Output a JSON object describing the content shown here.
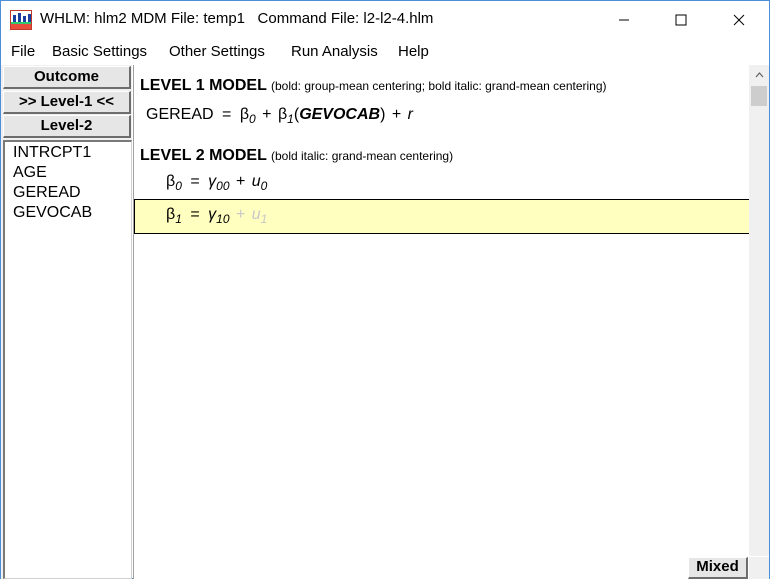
{
  "window": {
    "title": "WHLM: hlm2 MDM File: temp1   Command File: l2-l2-4.hlm"
  },
  "menu": {
    "items": [
      "File",
      "Basic Settings",
      "Other Settings",
      "Run Analysis",
      "Help"
    ]
  },
  "nav": {
    "outcome_label": "Outcome",
    "level1_label": ">> Level-1 <<",
    "level2_label": "Level-2"
  },
  "variables": [
    "INTRCPT1",
    "AGE",
    "GEREAD",
    "GEVOCAB"
  ],
  "level1": {
    "heading": "LEVEL 1 MODEL",
    "note": "(bold: group-mean centering; bold italic: grand-mean centering)",
    "equation": {
      "outcome": "GEREAD",
      "equals": "=",
      "b0": "β",
      "b0_sub": "0",
      "plus1": "+",
      "b1": "β",
      "b1_sub": "1",
      "predictor": "GEVOCAB",
      "plus2": "+",
      "error": "r"
    }
  },
  "level2": {
    "heading": "LEVEL 2 MODEL",
    "note": "(bold italic: grand-mean centering)",
    "eq1": {
      "lhs": "β",
      "lhs_sub": "0",
      "equals": "=",
      "gamma": "γ",
      "gamma_sub": "00",
      "plus": "+",
      "u": "u",
      "u_sub": "0"
    },
    "eq2": {
      "lhs": "β",
      "lhs_sub": "1",
      "equals": "=",
      "gamma": "γ",
      "gamma_sub": "10",
      "plus": "+",
      "u": "u",
      "u_sub": "1"
    }
  },
  "footer": {
    "mixed_label": "Mixed"
  },
  "colors": {
    "selection": "#ffffc0",
    "disabled_term": "#c8c8c8"
  }
}
